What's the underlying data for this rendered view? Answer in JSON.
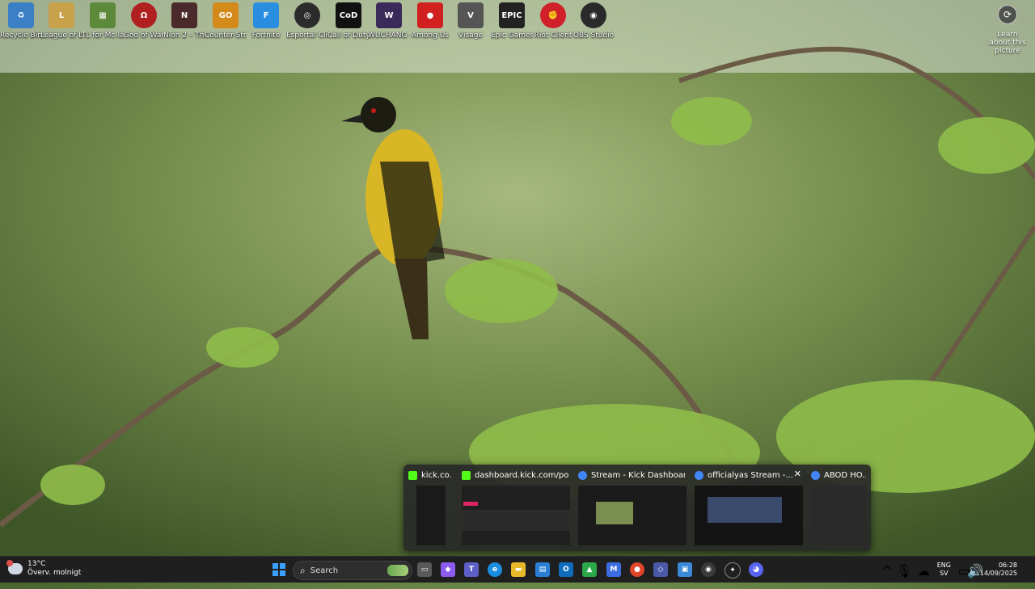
{
  "desktop": {
    "icons": [
      {
        "label": "Recycle Bin",
        "icon": "recycle-bin-icon",
        "color": "#3b7fc4"
      },
      {
        "label": "League of Legends",
        "icon": "league-of-legends-icon",
        "color": "#c8a24a"
      },
      {
        "label": "TL for Mc-launch...",
        "icon": "minecraft-icon",
        "color": "#5c8a3a"
      },
      {
        "label": "God of War",
        "icon": "god-of-war-icon",
        "color": "#b02020"
      },
      {
        "label": "Nioh 2 – The Complete ...",
        "icon": "nioh-icon",
        "color": "#4a2a2a"
      },
      {
        "label": "Counter-Str... Global Offe...",
        "icon": "csgo-icon",
        "color": "#d48a1a"
      },
      {
        "label": "Fortnite",
        "icon": "fortnite-icon",
        "color": "#2a8ee0"
      },
      {
        "label": "Esportal Client",
        "icon": "esportal-icon",
        "color": "#2b2b2b"
      },
      {
        "label": "Call of Duty®",
        "icon": "call-of-duty-icon",
        "color": "#111111"
      },
      {
        "label": "WUCHANG – Fallen Feat...",
        "icon": "wuchang-icon",
        "color": "#3a2a5a"
      },
      {
        "label": "Among Us",
        "icon": "among-us-icon",
        "color": "#d02020"
      },
      {
        "label": "Visage",
        "icon": "visage-icon",
        "color": "#555555"
      },
      {
        "label": "Epic Games Launcher",
        "icon": "epic-games-icon",
        "color": "#222222"
      },
      {
        "label": "Riot Client",
        "icon": "riot-client-icon",
        "color": "#d0202a"
      },
      {
        "label": "OBS Studio",
        "icon": "obs-studio-icon",
        "color": "#2a2a2a"
      }
    ],
    "learn": {
      "label": "Learn about this picture",
      "glyph": "⟳"
    }
  },
  "preview": {
    "thumbs": [
      {
        "title": "kick.co...",
        "fav_color": "#53fc18"
      },
      {
        "title": "dashboard.kick.com/popo...",
        "fav_color": "#53fc18"
      },
      {
        "title": "Stream - Kick Dashboard -...",
        "fav_color": "#4285f4"
      },
      {
        "title": "officialyas Stream -...",
        "fav_color": "#4285f4",
        "close": "✕"
      },
      {
        "title": "ABOD HO...",
        "fav_color": "#4285f4"
      }
    ]
  },
  "taskbar": {
    "weather": {
      "temp": "13°C",
      "desc": "Överv. molnigt"
    },
    "search_placeholder": "Search",
    "apps": [
      {
        "name": "task-view-icon",
        "color": "#5a5a5a"
      },
      {
        "name": "copilot-icon",
        "color": "#8a5cf0"
      },
      {
        "name": "teams-icon",
        "color": "#5b5fc7"
      },
      {
        "name": "edge-icon",
        "color": "#1b8ee0"
      },
      {
        "name": "file-explorer-icon",
        "color": "#e8b92a"
      },
      {
        "name": "store-icon",
        "color": "#2a7fd4"
      },
      {
        "name": "outlook-icon",
        "color": "#0f6cbd"
      },
      {
        "name": "vpn-icon",
        "color": "#2aa84a"
      },
      {
        "name": "m365-icon",
        "color": "#3b6de0"
      },
      {
        "name": "chrome-icon",
        "color": "#e0452a"
      },
      {
        "name": "cube-app-icon",
        "color": "#4a5aa8"
      },
      {
        "name": "photos-icon",
        "color": "#3a8ad8"
      },
      {
        "name": "obs-taskbar-icon",
        "color": "#3a3a3a"
      },
      {
        "name": "chatgpt-icon",
        "color": "#1f1f1f"
      },
      {
        "name": "discord-icon",
        "color": "#5865f2"
      }
    ],
    "lang": {
      "line1": "ENG",
      "line2": "SV"
    },
    "clock": {
      "time": "06:28",
      "date": "14/09/2025"
    },
    "tray": {
      "chevron": "^",
      "wifi": "◠",
      "speaker": "🔊"
    }
  }
}
